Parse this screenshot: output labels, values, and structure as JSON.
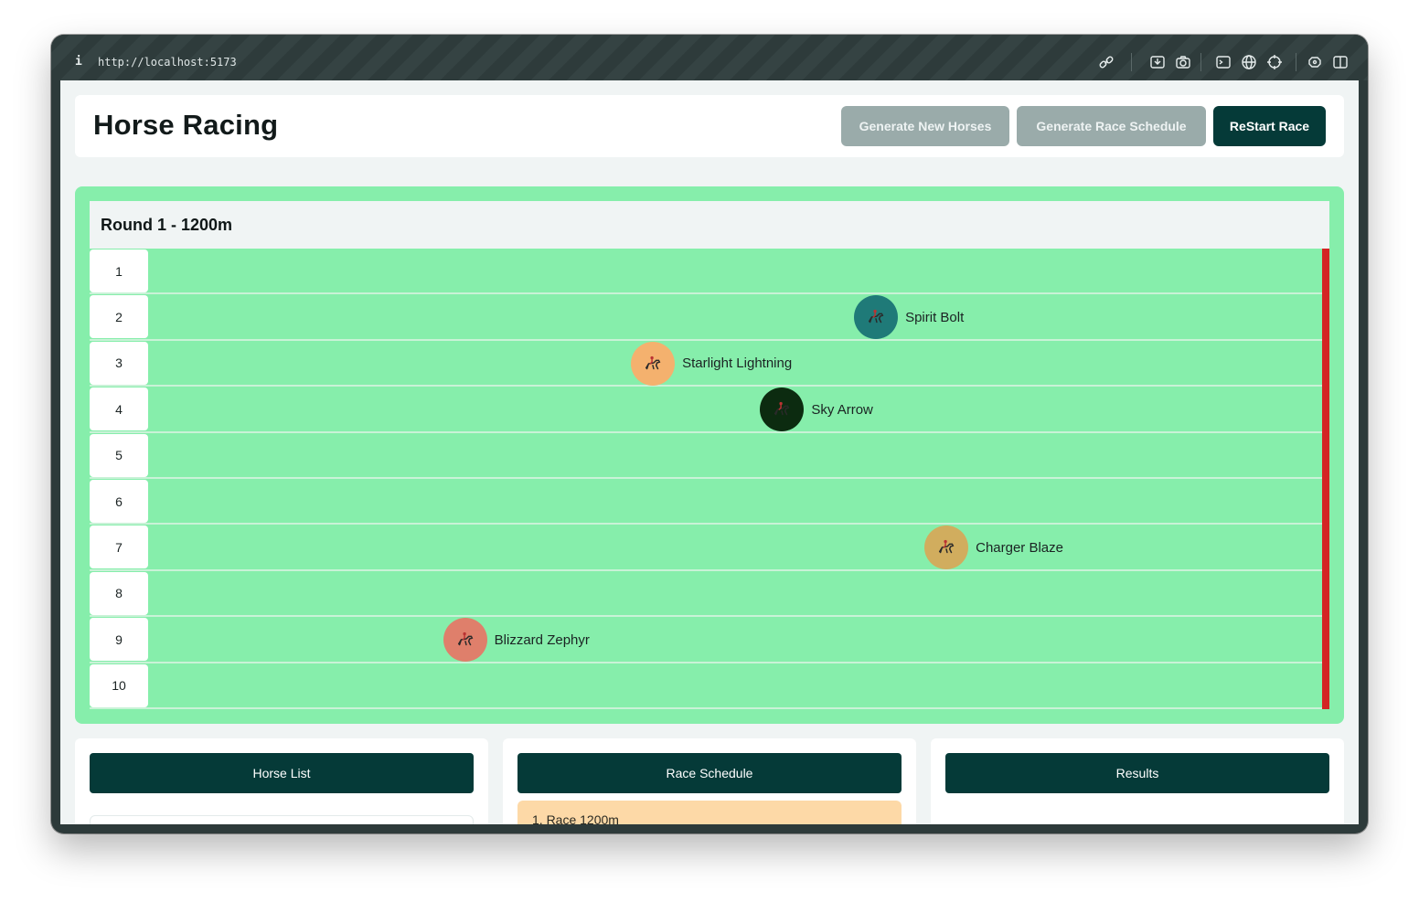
{
  "browser": {
    "url": "http://localhost:5173",
    "info_glyph": "i"
  },
  "header": {
    "title": "Horse Racing",
    "buttons": {
      "generate_horses": "Generate New Horses",
      "generate_schedule": "Generate Race Schedule",
      "restart": "ReStart Race"
    }
  },
  "race": {
    "round_title": "Round 1 - 1200m",
    "lanes": [
      {
        "number": "1"
      },
      {
        "number": "2"
      },
      {
        "number": "3"
      },
      {
        "number": "4"
      },
      {
        "number": "5"
      },
      {
        "number": "6"
      },
      {
        "number": "7"
      },
      {
        "number": "8"
      },
      {
        "number": "9"
      },
      {
        "number": "10"
      }
    ],
    "horses": [
      {
        "name": "Spirit Bolt",
        "lane": 2,
        "progress": 0.62,
        "color": "#1f7a78"
      },
      {
        "name": "Starlight Lightning",
        "lane": 3,
        "progress": 0.43,
        "color": "#f4b16e"
      },
      {
        "name": "Sky Arrow",
        "lane": 4,
        "progress": 0.54,
        "color": "#0c2b10"
      },
      {
        "name": "Charger Blaze",
        "lane": 7,
        "progress": 0.68,
        "color": "#d1ad5e"
      },
      {
        "name": "Blizzard Zephyr",
        "lane": 9,
        "progress": 0.27,
        "color": "#df7f6b"
      }
    ],
    "finish_color": "#d42424"
  },
  "panels": {
    "horse_list": "Horse List",
    "race_schedule": "Race Schedule",
    "results": "Results",
    "schedule_items": [
      "1. Race 1200m"
    ]
  }
}
